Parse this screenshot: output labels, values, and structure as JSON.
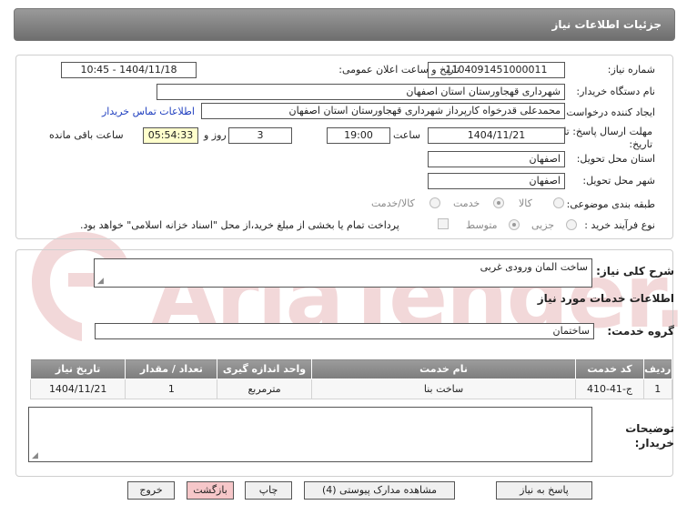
{
  "header": {
    "title": "جزئیات اطلاعات نیاز"
  },
  "watermark": {
    "text": "AriaTender.neT"
  },
  "form": {
    "need_number_label": "شماره نیاز:",
    "need_number": "1104091451000011",
    "announce_label": "تاریخ و ساعت اعلان عمومی:",
    "announce_value": "1404/11/18 - 10:45",
    "buyer_org_label": "نام دستگاه خریدار:",
    "buyer_org": "شهرداری قهجاورستان استان اصفهان",
    "creator_label": "ایجاد کننده درخواست:",
    "creator": "محمدعلی قدرخواه کارپرداز شهرداری قهجاورستان استان اصفهان",
    "contact_link": "اطلاعات تماس خریدار",
    "deadline_label_1": "مهلت ارسال پاسخ: تا",
    "deadline_label_2": "تاریخ:",
    "deadline_date": "1404/11/21",
    "time_label": "ساعت",
    "deadline_time": "19:00",
    "days_value": "3",
    "days_label": "روز و",
    "remaining_time": "05:54:33",
    "remaining_label": "ساعت باقی مانده",
    "province_label": "استان محل تحویل:",
    "province": "اصفهان",
    "city_label": "شهر محل تحویل:",
    "city": "اصفهان",
    "category_label": "طبقه بندی موضوعی:",
    "category_options": [
      "کالا",
      "خدمت",
      "کالا/خدمت"
    ],
    "category_selected": "خدمت",
    "process_label": "نوع فرآیند خرید :",
    "process_options": [
      "جزیی",
      "متوسط"
    ],
    "process_selected": "متوسط",
    "payment_note": "پرداخت تمام یا بخشی از مبلغ خرید،از محل \"اسناد خزانه اسلامی\" خواهد بود."
  },
  "details": {
    "summary_label": "شرح کلی نیاز:",
    "summary": "ساخت المان ورودی غربی",
    "services_heading": "اطلاعات خدمات مورد نیاز",
    "service_group_label": "گروه خدمت:",
    "service_group": "ساختمان",
    "table": {
      "headers": [
        "ردیف",
        "کد خدمت",
        "نام خدمت",
        "واحد اندازه گیری",
        "تعداد / مقدار",
        "تاریخ نیاز"
      ],
      "rows": [
        [
          "1",
          "ج-41-410",
          "ساخت بنا",
          "مترمربع",
          "1",
          "1404/11/21"
        ]
      ]
    },
    "buyer_notes_label_1": "توضیحات",
    "buyer_notes_label_2": "خریدار:",
    "buyer_notes": ""
  },
  "buttons": {
    "reply": "پاسخ به نیاز",
    "attachments": "مشاهده مدارک پیوستی (4)",
    "print": "چاپ",
    "back": "بازگشت",
    "exit": "خروج"
  }
}
